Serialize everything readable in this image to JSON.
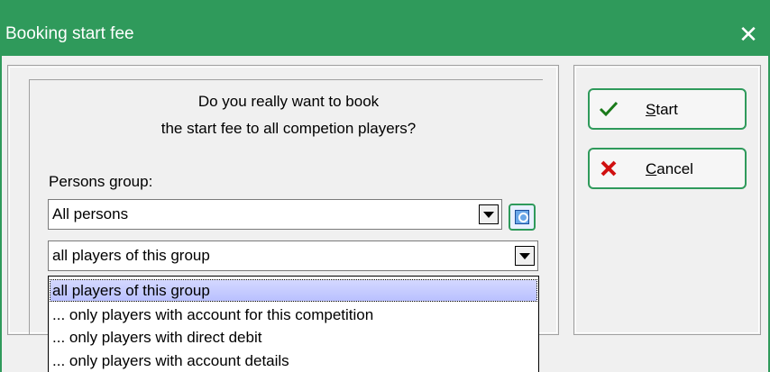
{
  "window": {
    "title": "Booking start fee",
    "close_glyph": "✕"
  },
  "question": {
    "line1": "Do you really want to book",
    "line2": "the start fee to all competion players?"
  },
  "persons_group": {
    "label": "Persons group:",
    "value": "All persons"
  },
  "filter": {
    "value": "all players of this group",
    "options": [
      "all players of this group",
      "... only players with account for this competition",
      "... only players with direct debit",
      "... only players with account details"
    ],
    "selected_index": 0
  },
  "buttons": {
    "start": {
      "mnemonic": "S",
      "rest": "tart",
      "icon": "check-icon"
    },
    "cancel": {
      "mnemonic": "C",
      "rest": "ancel",
      "icon": "cross-icon"
    }
  },
  "colors": {
    "accent": "#2f9a5b",
    "selection": "#c4caff"
  }
}
